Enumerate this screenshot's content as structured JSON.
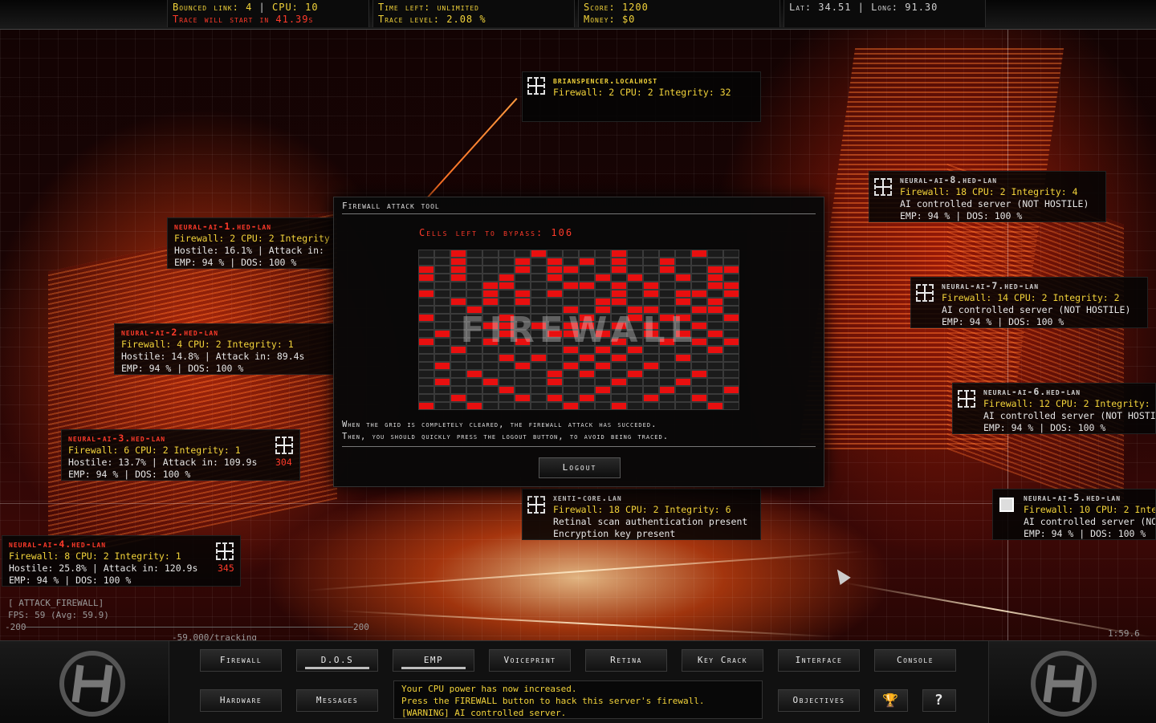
{
  "hud": {
    "bounced_link": "Bounced link: 4",
    "cpu": "CPU: 10",
    "trace_start": "Trace will start in 41.39s",
    "time_left": "Time left: unlimited",
    "trace_level": "Trace level: 2.08 %",
    "score": "Score: 1200",
    "money": "Money: $0",
    "lat": "Lat: 34.51",
    "long": "Long: 91.30"
  },
  "nodes": [
    {
      "title": "brianspencer.localhost",
      "l1": "Firewall: 2 CPU: 2 Integrity: 32",
      "l2": "",
      "l3": ""
    },
    {
      "title": "neural-ai-1.hed-lan",
      "l1": "Firewall: 2 CPU: 2 Integrity",
      "l2": "Hostile: 16.1% | Attack in:",
      "l3": "EMP:  94 % | DOS: 100 %"
    },
    {
      "title": "neural-ai-2.hed-lan",
      "l1": "Firewall: 4 CPU: 2 Integrity: 1",
      "l2": "Hostile: 14.8% | Attack in: 89.4s",
      "l3": "EMP:  94 % | DOS: 100 %"
    },
    {
      "title": "neural-ai-3.hed-lan",
      "l1": "Firewall: 6 CPU: 2 Integrity: 1",
      "l2": "Hostile: 13.7% | Attack in: 109.9s",
      "l3": "EMP:  94 % | DOS: 100 %",
      "num": "304"
    },
    {
      "title": "neural-ai-4.hed-lan",
      "l1": "Firewall: 8 CPU: 2 Integrity: 1",
      "l2": "Hostile: 25.8% | Attack in: 120.9s",
      "l3": "EMP:  94 % | DOS: 100 %",
      "num": "345"
    },
    {
      "title": "neural-ai-8.hed-lan",
      "l1": "Firewall: 18 CPU: 2 Integrity: 4",
      "l2": "AI controlled server (NOT HOSTILE)",
      "l3": "EMP:  94 % | DOS: 100 %"
    },
    {
      "title": "neural-ai-7.hed-lan",
      "l1": "Firewall: 14 CPU: 2 Integrity: 2",
      "l2": "AI controlled server (NOT HOSTILE)",
      "l3": "EMP:  94 % | DOS: 100 %"
    },
    {
      "title": "neural-ai-6.hed-lan",
      "l1": "Firewall: 12 CPU: 2 Integrity:",
      "l2": "AI controlled server (NOT HOSTI",
      "l3": "EMP:  94 % | DOS: 100 %"
    },
    {
      "title": "xenti-core.lan",
      "l1": "Firewall: 18 CPU: 2 Integrity: 6",
      "l2": "Retinal scan authentication present",
      "l3": "Encryption key present"
    },
    {
      "title": "neural-ai-5.hed-lan",
      "l1": "Firewall: 10 CPU: 2 Inte",
      "l2": "AI controlled server (NO",
      "l3": "EMP:  94 % | DOS: 100 %"
    }
  ],
  "modal": {
    "title": "Firewall attack tool",
    "cells_left": "Cells left to bypass: 106",
    "watermark": "FIREWALL",
    "desc1": "When the grid is completely cleared, the firewall attack has succeded.",
    "desc2": "Then, you should quickly press the logout button, to avoid being traced.",
    "logout": "Logout",
    "grid_cols": 20,
    "grid_rows": 20,
    "red_cells": [
      [
        2,
        0
      ],
      [
        7,
        0
      ],
      [
        12,
        0
      ],
      [
        17,
        0
      ],
      [
        2,
        1
      ],
      [
        6,
        1
      ],
      [
        8,
        1
      ],
      [
        10,
        1
      ],
      [
        12,
        1
      ],
      [
        15,
        1
      ],
      [
        0,
        2
      ],
      [
        2,
        2
      ],
      [
        6,
        2
      ],
      [
        8,
        2
      ],
      [
        9,
        2
      ],
      [
        12,
        2
      ],
      [
        15,
        2
      ],
      [
        18,
        2
      ],
      [
        19,
        2
      ],
      [
        0,
        3
      ],
      [
        2,
        3
      ],
      [
        5,
        3
      ],
      [
        8,
        3
      ],
      [
        11,
        3
      ],
      [
        13,
        3
      ],
      [
        16,
        3
      ],
      [
        18,
        3
      ],
      [
        4,
        4
      ],
      [
        5,
        4
      ],
      [
        9,
        4
      ],
      [
        10,
        4
      ],
      [
        12,
        4
      ],
      [
        14,
        4
      ],
      [
        18,
        4
      ],
      [
        19,
        4
      ],
      [
        0,
        5
      ],
      [
        4,
        5
      ],
      [
        6,
        5
      ],
      [
        8,
        5
      ],
      [
        12,
        5
      ],
      [
        14,
        5
      ],
      [
        16,
        5
      ],
      [
        17,
        5
      ],
      [
        19,
        5
      ],
      [
        2,
        6
      ],
      [
        4,
        6
      ],
      [
        6,
        6
      ],
      [
        11,
        6
      ],
      [
        12,
        6
      ],
      [
        16,
        6
      ],
      [
        18,
        6
      ],
      [
        3,
        7
      ],
      [
        9,
        7
      ],
      [
        11,
        7
      ],
      [
        13,
        7
      ],
      [
        14,
        7
      ],
      [
        17,
        7
      ],
      [
        18,
        7
      ],
      [
        0,
        8
      ],
      [
        5,
        8
      ],
      [
        10,
        8
      ],
      [
        13,
        8
      ],
      [
        15,
        8
      ],
      [
        16,
        8
      ],
      [
        19,
        8
      ],
      [
        4,
        9
      ],
      [
        5,
        9
      ],
      [
        7,
        9
      ],
      [
        9,
        9
      ],
      [
        10,
        9
      ],
      [
        12,
        9
      ],
      [
        14,
        9
      ],
      [
        17,
        9
      ],
      [
        1,
        10
      ],
      [
        5,
        10
      ],
      [
        8,
        10
      ],
      [
        9,
        10
      ],
      [
        11,
        10
      ],
      [
        14,
        10
      ],
      [
        16,
        10
      ],
      [
        18,
        10
      ],
      [
        0,
        11
      ],
      [
        4,
        11
      ],
      [
        6,
        11
      ],
      [
        12,
        11
      ],
      [
        15,
        11
      ],
      [
        17,
        11
      ],
      [
        19,
        11
      ],
      [
        2,
        12
      ],
      [
        9,
        12
      ],
      [
        11,
        12
      ],
      [
        13,
        12
      ],
      [
        18,
        12
      ],
      [
        5,
        13
      ],
      [
        7,
        13
      ],
      [
        10,
        13
      ],
      [
        12,
        13
      ],
      [
        16,
        13
      ],
      [
        1,
        14
      ],
      [
        6,
        14
      ],
      [
        9,
        14
      ],
      [
        11,
        14
      ],
      [
        14,
        14
      ],
      [
        3,
        15
      ],
      [
        8,
        15
      ],
      [
        10,
        15
      ],
      [
        13,
        15
      ],
      [
        17,
        15
      ],
      [
        1,
        16
      ],
      [
        4,
        16
      ],
      [
        8,
        16
      ],
      [
        12,
        16
      ],
      [
        16,
        16
      ],
      [
        5,
        17
      ],
      [
        11,
        17
      ],
      [
        15,
        17
      ],
      [
        19,
        17
      ],
      [
        2,
        18
      ],
      [
        6,
        18
      ],
      [
        8,
        18
      ],
      [
        10,
        18
      ],
      [
        14,
        18
      ],
      [
        17,
        18
      ],
      [
        0,
        19
      ],
      [
        3,
        19
      ],
      [
        9,
        19
      ],
      [
        12,
        19
      ],
      [
        18,
        19
      ]
    ]
  },
  "debug": {
    "cmd": "[ ATTACK_FIREWALL]",
    "fps": "FPS:  59 (Avg: 59.9)",
    "axis_left": "-200",
    "axis_right": "200",
    "tracking": "-59.000/tracking",
    "timer": "1:59.6"
  },
  "toolbar": {
    "row1": [
      "Firewall",
      "D.O.S",
      "EMP",
      "Voiceprint",
      "Retina",
      "Key Crack",
      "Interface",
      "Console"
    ],
    "row2_left": [
      "Hardware",
      "Messages"
    ],
    "objectives": "Objectives",
    "trophy_icon": "🏆",
    "help_icon": "?",
    "messages": [
      "Your CPU power has now increased.",
      "Press the FIREWALL button to hack this server's firewall.",
      "[WARNING] AI controlled server."
    ]
  },
  "colors": {
    "accent_red": "#ff3a2a",
    "accent_yellow": "#f2d33a",
    "cell_red": "#e80f0f"
  }
}
